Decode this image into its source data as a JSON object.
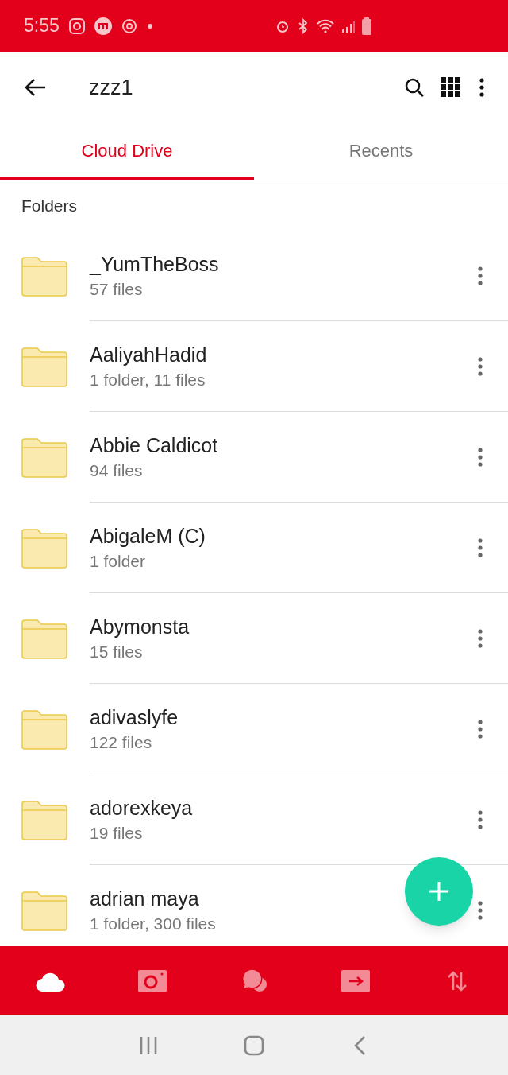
{
  "status_bar": {
    "time": "5:55"
  },
  "header": {
    "title": "zzz1"
  },
  "tabs": [
    {
      "label": "Cloud Drive",
      "selected": true
    },
    {
      "label": "Recents",
      "selected": false
    }
  ],
  "section_label": "Folders",
  "folders": [
    {
      "name": "_YumTheBoss",
      "info": "57 files"
    },
    {
      "name": "AaliyahHadid",
      "info": "1 folder, 11 files"
    },
    {
      "name": "Abbie Caldicot",
      "info": "94 files"
    },
    {
      "name": "AbigaleM (C)",
      "info": "1 folder"
    },
    {
      "name": "Abymonsta",
      "info": "15 files"
    },
    {
      "name": "adivaslyfe",
      "info": "122 files"
    },
    {
      "name": "adorexkeya",
      "info": "19 files"
    },
    {
      "name": "adrian maya",
      "info": "1 folder, 300 files"
    }
  ],
  "bottom_nav": [
    {
      "kind": "cloud",
      "selected": true
    },
    {
      "kind": "camera",
      "selected": false
    },
    {
      "kind": "chat",
      "selected": false
    },
    {
      "kind": "shared",
      "selected": false
    },
    {
      "kind": "transfers",
      "selected": false
    }
  ]
}
